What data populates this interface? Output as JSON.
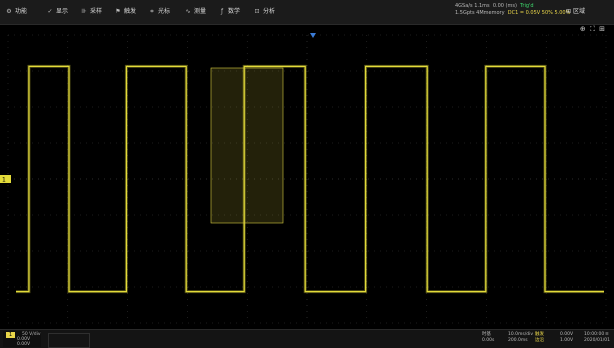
{
  "toolbar": {
    "items": [
      {
        "label": "功能",
        "icon": "gear-icon"
      },
      {
        "label": "显示",
        "icon": "display-icon"
      },
      {
        "label": "采样",
        "icon": "sample-icon"
      },
      {
        "label": "触发",
        "icon": "trigger-flag-icon"
      },
      {
        "label": "光标",
        "icon": "cursor-icon"
      },
      {
        "label": "测量",
        "icon": "measure-icon"
      },
      {
        "label": "数学",
        "icon": "math-icon"
      },
      {
        "label": "分析",
        "icon": "analysis-icon"
      }
    ],
    "status": {
      "line1_a": "4GSa/s",
      "line1_b": "1.1ms",
      "line1_c": "0.00 (ms)",
      "line1_d": "Trig'd",
      "line2_a": "1.5Gpts 4Mmemory",
      "line2_b": "DC1 = 0.05V 50%",
      "line2_c": "5.00%"
    },
    "area_label": "区域"
  },
  "screen_icons": "⊕ ⛶ ⊞",
  "colors": {
    "trace": "#e3db3a",
    "grid": "#3a3a3a",
    "zoom_box": "#d8cc40",
    "trigger_marker": "#3a7bd5"
  },
  "waveform": {
    "type": "square",
    "high_level": 0.92,
    "low_level": -0.92,
    "transitions": [
      0.035,
      0.102,
      0.198,
      0.298,
      0.395,
      0.497,
      0.598,
      0.701,
      0.799,
      0.898
    ],
    "start_level": "low",
    "end_level": "low"
  },
  "bottom": {
    "ch1_tag": "1",
    "ch1_value1": "50 V/div",
    "ch1_value2": "0.00V",
    "ch1_line3": "0.00V",
    "time_label": "时基",
    "time_div": "10.0ms/div",
    "time_offset": "0.00s",
    "time_pos": "200.0ms",
    "trig_label": "触发",
    "trig_mode": "边沿",
    "trig_level": "0.00V",
    "trig_val": "1.00V",
    "date": "2020/01/01",
    "clock": "10:00:00",
    "extra": "≡"
  }
}
